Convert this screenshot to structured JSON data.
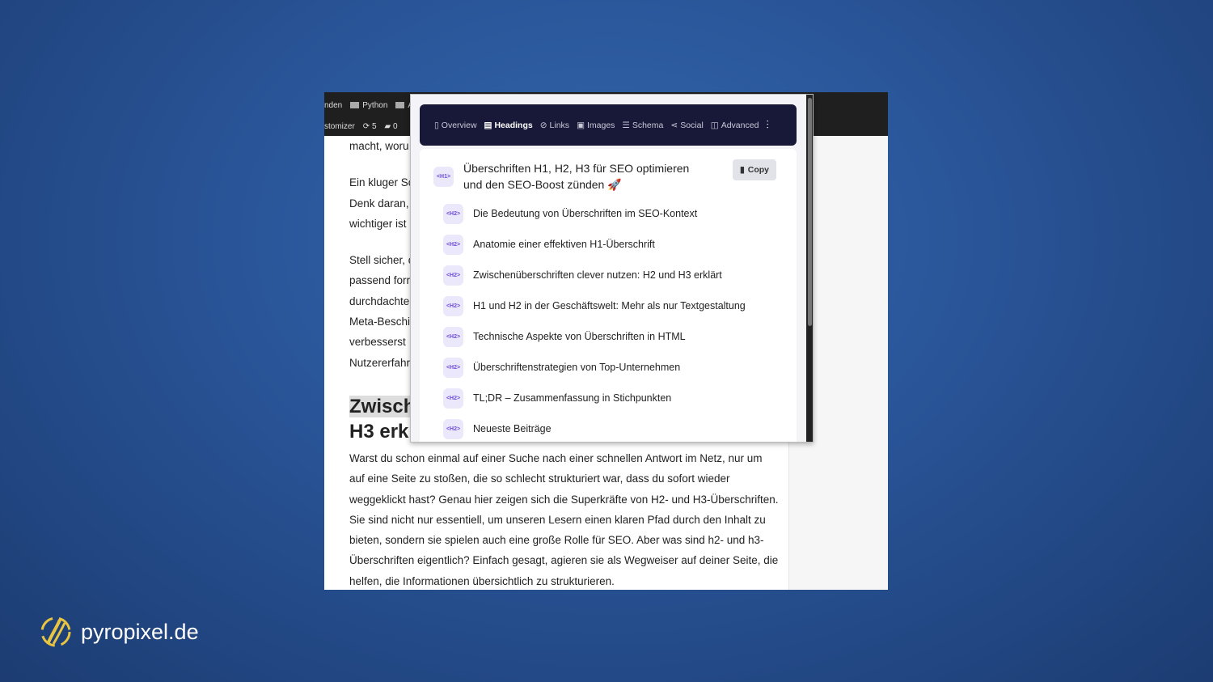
{
  "browser": {
    "row1": [
      "nden",
      "Python",
      "A"
    ],
    "row2": {
      "customizer": "stomizer",
      "updates": "5",
      "comments": "0"
    }
  },
  "article": {
    "lines_top": [
      "macht, woru"
    ],
    "para2": [
      "Ein kluger Sc",
      "Denk daran,",
      "wichtiger ist"
    ],
    "para3": [
      "Stell sicher, c",
      "passend forr",
      "durchdachte",
      "Meta-Beschi",
      "verbesserst",
      "Nutzererfahr"
    ],
    "heading": [
      "Zwisch",
      "H3 erkl"
    ],
    "body": [
      "Warst du schon einmal auf einer Suche nach einer schnellen Antwort im Netz, nur um",
      "auf eine Seite zu stoßen, die so schlecht strukturiert war, dass du sofort wieder",
      "weggeklickt hast? Genau hier zeigen sich die Superkräfte von H2- und H3-Überschriften.",
      "Sie sind nicht nur essentiell, um unseren Lesern einen klaren Pfad durch den Inhalt zu",
      "bieten, sondern sie spielen auch eine große Rolle für SEO. Aber was sind h2- und h3-",
      "Überschriften eigentlich? Einfach gesagt, agieren sie als Wegweiser auf deiner Seite, die",
      "helfen, die Informationen übersichtlich zu strukturieren."
    ]
  },
  "popup": {
    "tabs": [
      {
        "label": "Overview",
        "icon": "book-icon"
      },
      {
        "label": "Headings",
        "icon": "document-icon",
        "active": true
      },
      {
        "label": "Links",
        "icon": "link-icon"
      },
      {
        "label": "Images",
        "icon": "image-icon"
      },
      {
        "label": "Schema",
        "icon": "list-icon"
      },
      {
        "label": "Social",
        "icon": "share-icon"
      },
      {
        "label": "Advanced",
        "icon": "advanced-icon"
      }
    ],
    "h1": {
      "tag": "<H1>",
      "text": "Überschriften H1, H2, H3 für SEO optimieren und den SEO-Boost zünden 🚀"
    },
    "copy_label": "Copy",
    "h2_tag": "<H2>",
    "h2": [
      "Die Bedeutung von Überschriften im SEO-Kontext",
      "Anatomie einer effektiven H1-Überschrift",
      "Zwischenüberschriften clever nutzen: H2 und H3 erklärt",
      "H1 und H2 in der Geschäftswelt: Mehr als nur Textgestaltung",
      "Technische Aspekte von Überschriften in HTML",
      "Überschriftenstrategien von Top-Unternehmen",
      "TL;DR – Zusammenfassung in Stichpunkten",
      "Neueste Beiträge"
    ]
  },
  "brand": {
    "name": "pyropixel.de",
    "color": "#e8c440"
  }
}
